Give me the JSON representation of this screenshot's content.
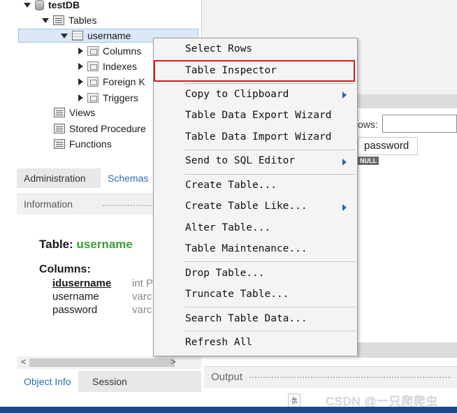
{
  "tree": {
    "database": "testDB",
    "tables_label": "Tables",
    "selected_table": "username",
    "children": [
      "Columns",
      "Indexes",
      "Foreign K",
      "Triggers"
    ],
    "views_label": "Views",
    "procedures_label": "Stored Procedure",
    "functions_label": "Functions"
  },
  "sidebar_tabs": [
    "Administration",
    "Schemas"
  ],
  "info_panel": {
    "header": "Information",
    "table_label": "Table:",
    "table_name": "username",
    "columns_label": "Columns:",
    "columns": [
      {
        "name": "idusername",
        "type": "int P"
      },
      {
        "name": "username",
        "type": "varc"
      },
      {
        "name": "password",
        "type": "varc"
      }
    ]
  },
  "scroll_arrows": {
    "left": "<",
    "right": ">"
  },
  "bottom_tabs": [
    "Object Info",
    "Session"
  ],
  "result_grid": {
    "rows_label": "ows:",
    "column_header": "password",
    "null_badge": "NULL"
  },
  "output_panel": {
    "title": "Output"
  },
  "side_badge": "45",
  "watermark": "CSDN @一只爬爬虫",
  "context_menu": {
    "items": [
      {
        "label": "Select Rows",
        "submenu": false
      },
      {
        "label": "Table Inspector",
        "submenu": false,
        "highlighted": true
      },
      {
        "label": "Copy to Clipboard",
        "submenu": true
      },
      {
        "label": "Table Data Export Wizard",
        "submenu": false
      },
      {
        "label": "Table Data Import Wizard",
        "submenu": false
      },
      {
        "label": "Send to SQL Editor",
        "submenu": true
      },
      {
        "label": "Create Table...",
        "submenu": false
      },
      {
        "label": "Create Table Like...",
        "submenu": true
      },
      {
        "label": "Alter Table...",
        "submenu": false
      },
      {
        "label": "Table Maintenance...",
        "submenu": false
      },
      {
        "label": "Drop Table...",
        "submenu": false
      },
      {
        "label": "Truncate Table...",
        "submenu": false
      },
      {
        "label": "Search Table Data...",
        "submenu": false
      },
      {
        "label": "Refresh All",
        "submenu": false
      }
    ]
  },
  "colors": {
    "accent": "#2d6cb5",
    "table_name": "#3b9e3b",
    "highlight_box": "#e01818",
    "submenu_arrow": "#2f63b8"
  }
}
